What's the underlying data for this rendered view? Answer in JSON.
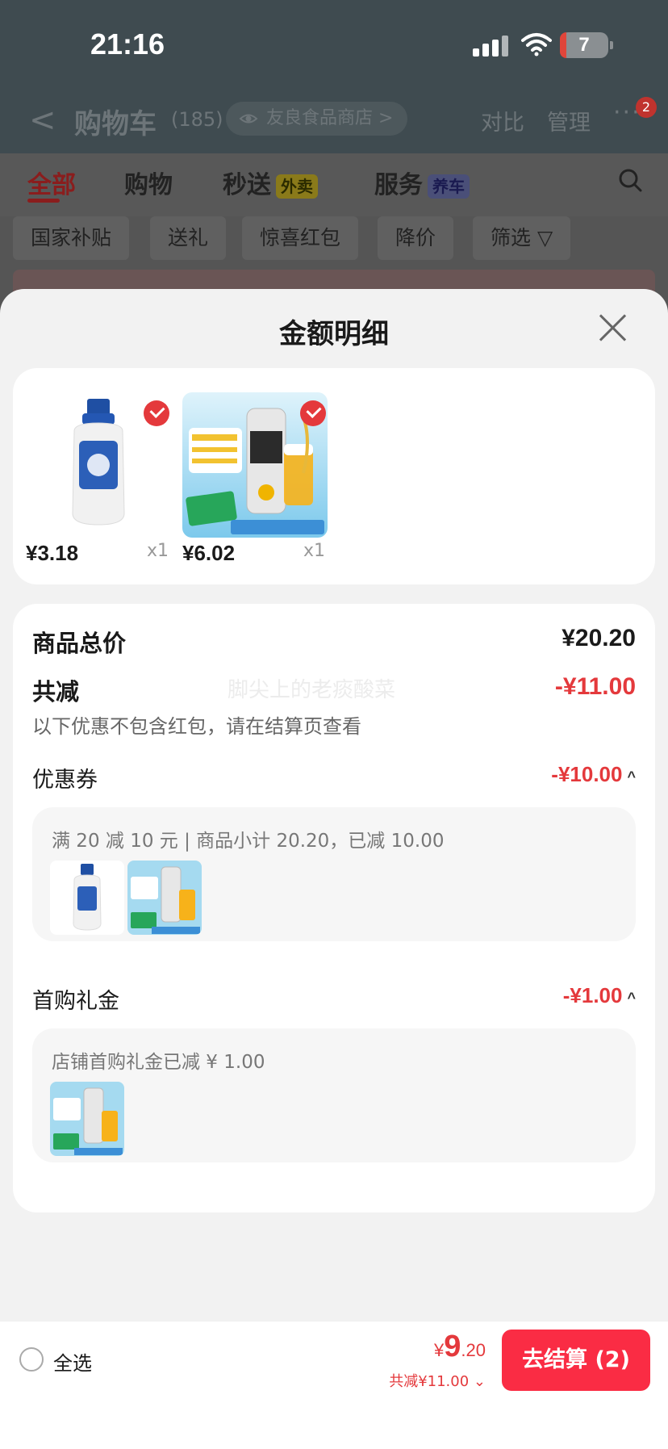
{
  "status_bar": {
    "time": "21:16",
    "battery": "7"
  },
  "nav": {
    "back": "<",
    "title": "购物车",
    "count": "(185)",
    "store": "友良食品商店 >",
    "compare": "对比",
    "manage": "管理",
    "more": "···",
    "badge": "2"
  },
  "tabs": {
    "all": "全部",
    "shopping": "购物",
    "flash": "秒送",
    "flash_tag": "外卖",
    "service": "服务",
    "service_tag": "养车"
  },
  "filters": [
    "国家补贴",
    "送礼",
    "惊喜红包",
    "降价",
    "筛选 ▽"
  ],
  "sheet": {
    "title": "金额明细",
    "products": [
      {
        "price": "¥3.18",
        "qty": "x1"
      },
      {
        "price": "¥6.02",
        "qty": "x1"
      }
    ],
    "total_label": "商品总价",
    "total_value": "¥20.20",
    "discount_label": "共减",
    "discount_value": "-¥11.00",
    "watermark": "脚尖上的老痰酸菜",
    "note": "以下优惠不包含红包，请在结算页查看",
    "coupon": {
      "label": "优惠券",
      "value": "-¥10.00",
      "chevron": "^",
      "detail": "满 20 减 10 元 | 商品小计 20.20，已减 10.00"
    },
    "first_gift": {
      "label": "首购礼金",
      "value": "-¥1.00",
      "chevron": "^",
      "detail": "店铺首购礼金已减 ¥ 1.00"
    }
  },
  "bottom_bar": {
    "select_all": "全选",
    "currency": "¥",
    "price_int": "9",
    "price_dec": ".20",
    "discount": "共减¥11.00 ⌄",
    "checkout": "去结算 (2)"
  },
  "colors": {
    "accent_red": "#e4393c",
    "checkout_red": "#fa2c44"
  }
}
